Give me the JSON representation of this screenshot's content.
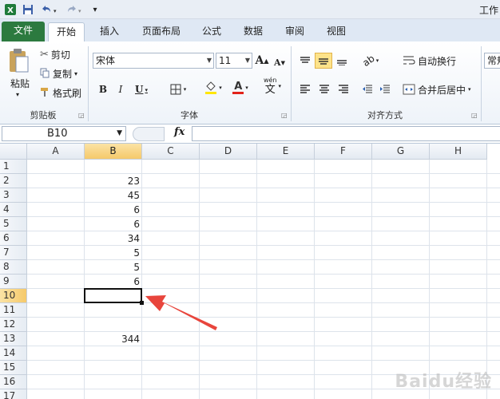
{
  "window": {
    "title": "工作"
  },
  "tabs": [
    {
      "label": "文件"
    },
    {
      "label": "开始"
    },
    {
      "label": "插入"
    },
    {
      "label": "页面布局"
    },
    {
      "label": "公式"
    },
    {
      "label": "数据"
    },
    {
      "label": "审阅"
    },
    {
      "label": "视图"
    }
  ],
  "ribbon": {
    "clipboard": {
      "paste": "粘贴",
      "cut": "剪切",
      "copy": "复制",
      "format_painter": "格式刷",
      "label": "剪贴板"
    },
    "font": {
      "name": "宋体",
      "size": "11",
      "bold": "B",
      "italic": "I",
      "underline": "U",
      "grow": "A",
      "shrink": "A",
      "color": "A",
      "wen": "wén",
      "wen_char": "文",
      "label": "字体"
    },
    "alignment": {
      "wrap_text": "自动换行",
      "merge_center": "合并后居中",
      "label": "对齐方式"
    },
    "number": {
      "format": "常规"
    }
  },
  "formula_bar": {
    "name_box": "B10",
    "fx": "fx",
    "value": ""
  },
  "sheet": {
    "columns": [
      "A",
      "B",
      "C",
      "D",
      "E",
      "F",
      "G",
      "H"
    ],
    "rows": [
      "1",
      "2",
      "3",
      "4",
      "5",
      "6",
      "7",
      "8",
      "9",
      "10",
      "11",
      "12",
      "13",
      "14",
      "15",
      "16",
      "17"
    ],
    "selected_cell": "B10",
    "cells": [
      {
        "ref": "B2",
        "value": "23"
      },
      {
        "ref": "B3",
        "value": "45"
      },
      {
        "ref": "B4",
        "value": "6"
      },
      {
        "ref": "B5",
        "value": "6"
      },
      {
        "ref": "B6",
        "value": "34"
      },
      {
        "ref": "B7",
        "value": "5"
      },
      {
        "ref": "B8",
        "value": "5"
      },
      {
        "ref": "B9",
        "value": "6"
      },
      {
        "ref": "B13",
        "value": "344"
      }
    ]
  },
  "colors": {
    "accent_arrow": "#e8453c",
    "file_tab": "#2c7a3f",
    "selection_header": "#f5c96a"
  },
  "watermark": "Baidu经验"
}
